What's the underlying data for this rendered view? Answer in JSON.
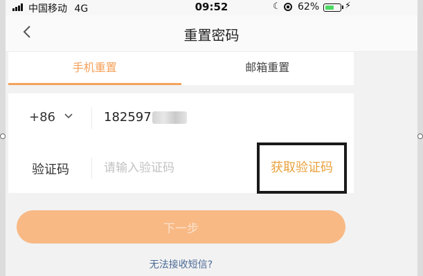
{
  "status_bar": {
    "carrier": "中国移动",
    "network": "4G",
    "time": "09:52",
    "battery_percent": "62%",
    "battery_level": 0.62,
    "icons": [
      "signal-icon",
      "moon-icon",
      "rotation-lock-icon",
      "battery-icon",
      "charging-bolt-icon"
    ]
  },
  "nav": {
    "title": "重置密码",
    "back_icon": "chevron-left-icon"
  },
  "tabs": [
    {
      "label": "手机重置",
      "active": true
    },
    {
      "label": "邮箱重置",
      "active": false
    }
  ],
  "form": {
    "country_code": "+86",
    "phone_number_visible": "182597",
    "code_label": "验证码",
    "code_placeholder": "请输入验证码",
    "get_code_label": "获取验证码"
  },
  "next_button": {
    "label": "下一步"
  },
  "help_link": "无法接收短信?",
  "colors": {
    "accent": "#f5a15a",
    "get_code_text": "#e9a23e",
    "next_button_bg": "#f8b985",
    "link": "#4b6b96",
    "battery_fill": "#4cd964"
  }
}
